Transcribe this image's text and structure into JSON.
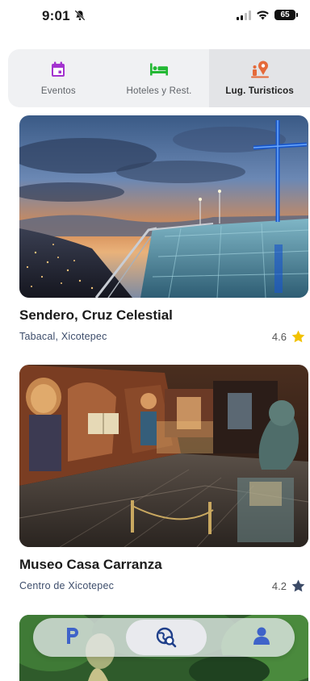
{
  "status": {
    "time": "9:01",
    "battery": "65"
  },
  "tabs": [
    {
      "label": "Eventos",
      "icon": "calendar-icon",
      "color": "#a333cf"
    },
    {
      "label": "Hoteles y Rest.",
      "icon": "bed-icon",
      "color": "#22b833"
    },
    {
      "label": "Lug. Turisticos",
      "icon": "tourist-place-icon",
      "color": "#e56a3a"
    }
  ],
  "places": [
    {
      "title": "Sendero, Cruz Celestial",
      "location": "Tabacal, Xicotepec",
      "rating": "4.6",
      "star_color": "#f2c200"
    },
    {
      "title": "Museo Casa Carranza",
      "location": "Centro de Xicotepec",
      "rating": "4.2",
      "star_color": "#3b4a66"
    }
  ],
  "bottom_nav": [
    {
      "icon": "parking-icon"
    },
    {
      "icon": "globe-search-icon"
    },
    {
      "icon": "user-icon"
    }
  ],
  "colors": {
    "accent_text": "#3d4d6b",
    "tab_bg": "#f0f1f3"
  }
}
